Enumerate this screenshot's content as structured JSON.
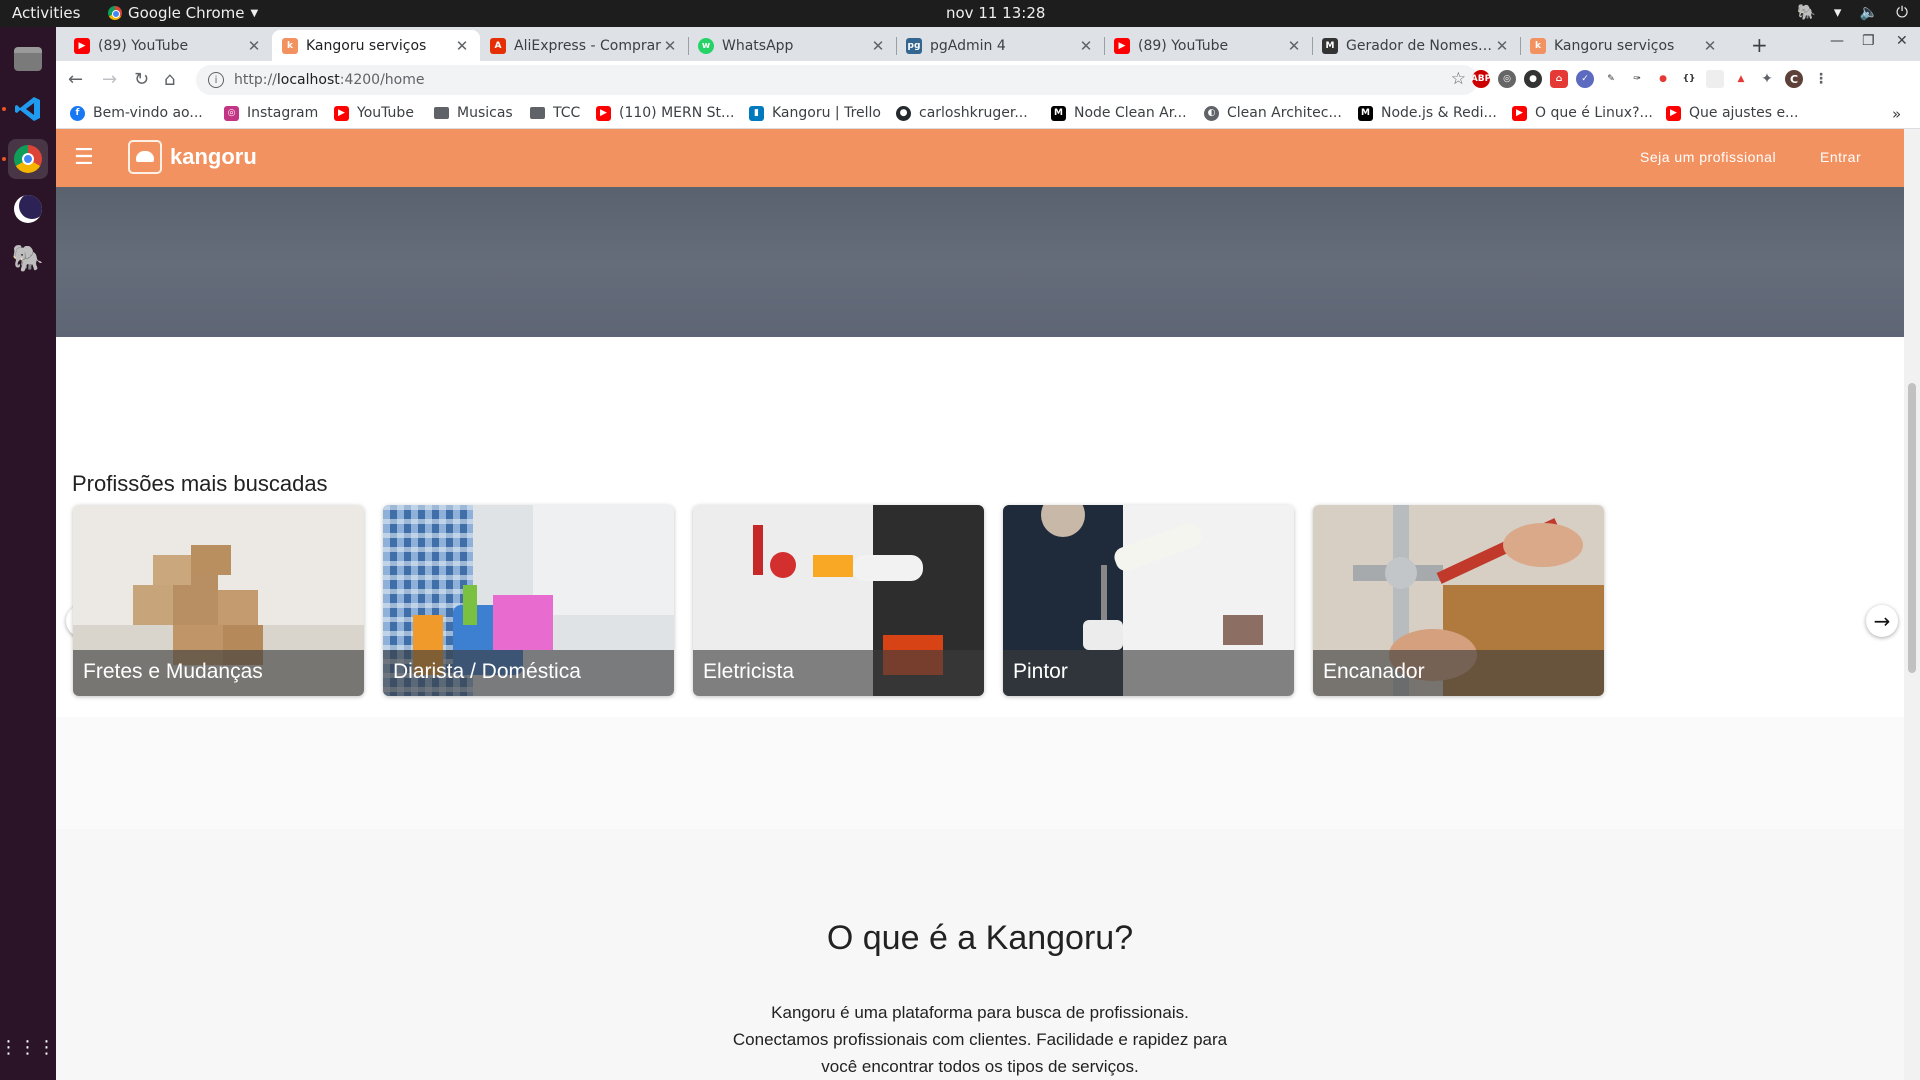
{
  "system": {
    "activities": "Activities",
    "app_name": "Google Chrome",
    "clock": "nov 11  13:28"
  },
  "tabs": [
    {
      "title": "(89) YouTube",
      "favicon": "youtube-icon",
      "color": "#ff0000"
    },
    {
      "title": "Kangoru serviços",
      "favicon": "kangoru-icon",
      "color": "#f39261",
      "active": true
    },
    {
      "title": "AliExpress - Comprar",
      "favicon": "aliexpress-icon",
      "color": "#e62e04"
    },
    {
      "title": "WhatsApp",
      "favicon": "whatsapp-icon",
      "color": "#25d366"
    },
    {
      "title": "pgAdmin 4",
      "favicon": "pgadmin-icon",
      "color": "#336791"
    },
    {
      "title": "(89) YouTube",
      "favicon": "youtube-icon",
      "color": "#ff0000"
    },
    {
      "title": "Gerador de Nomes or",
      "favicon": "gerador-icon",
      "color": "#333333"
    },
    {
      "title": "Kangoru serviços",
      "favicon": "kangoru-icon",
      "color": "#f39261"
    }
  ],
  "address_bar": {
    "prefix": "http://",
    "host": "localhost",
    "path": ":4200/home"
  },
  "bookmarks": [
    {
      "label": "Bem-vindo ao...",
      "icon": "facebook-icon",
      "color": "#1877f2"
    },
    {
      "label": "Instagram",
      "icon": "instagram-icon",
      "color": "#c13584"
    },
    {
      "label": "YouTube",
      "icon": "youtube-icon",
      "color": "#ff0000"
    },
    {
      "label": "Musicas",
      "icon": "folder-icon"
    },
    {
      "label": "TCC",
      "icon": "folder-icon"
    },
    {
      "label": "(110) MERN St...",
      "icon": "youtube-icon",
      "color": "#ff0000"
    },
    {
      "label": "Kangoru | Trello",
      "icon": "trello-icon",
      "color": "#0079bf"
    },
    {
      "label": "carloshkruger...",
      "icon": "github-icon",
      "color": "#24292e"
    },
    {
      "label": "Node Clean Ar...",
      "icon": "medium-icon",
      "color": "#000000"
    },
    {
      "label": "Clean Architec...",
      "icon": "globe-icon",
      "color": "#5f6368"
    },
    {
      "label": "Node.js & Redi...",
      "icon": "medium-icon",
      "color": "#000000"
    },
    {
      "label": "O que é Linux?...",
      "icon": "youtube-icon",
      "color": "#ff0000"
    },
    {
      "label": "Que ajustes e...",
      "icon": "youtube-icon",
      "color": "#ff0000"
    }
  ],
  "app": {
    "brand": "kangoru",
    "brand_color": "#f39261",
    "nav_professional": "Seja um profissional",
    "nav_login": "Entrar"
  },
  "professions": {
    "title": "Profissões mais buscadas",
    "items": [
      {
        "label": "Fretes e Mudanças",
        "image": "moving-boxes"
      },
      {
        "label": "Diarista / Doméstica",
        "image": "cleaning-supplies"
      },
      {
        "label": "Eletricista",
        "image": "electrician"
      },
      {
        "label": "Pintor",
        "image": "painter-roller"
      },
      {
        "label": "Encanador",
        "image": "plumber-wrench"
      }
    ]
  },
  "about": {
    "title": "O que é a Kangoru?",
    "line1": "Kangoru é uma plataforma para busca de profissionais.",
    "line2": "Conectamos profissionais com clientes. Facilidade e rapidez para",
    "line3": "você encontrar todos os tipos de serviços."
  }
}
